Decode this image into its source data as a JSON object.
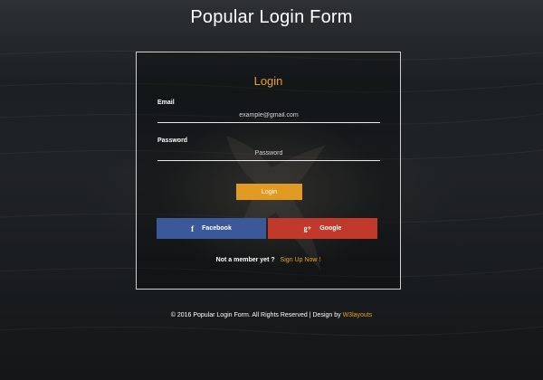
{
  "page": {
    "title": "Popular Login Form"
  },
  "form": {
    "heading": "Login",
    "email_label": "Email",
    "email_placeholder": "example@gmail.com",
    "password_label": "Password",
    "password_placeholder": "Password",
    "login_button": "Login",
    "facebook_label": "Facebook",
    "facebook_icon": "f",
    "google_label": "Google",
    "google_icon": "g+",
    "signup_prompt": "Not a member yet ?",
    "signup_link": "Sign Up Now !"
  },
  "footer": {
    "text": "© 2016 Popular Login Form. All Rights Reserved | Design by",
    "link": "W3layouts"
  },
  "colors": {
    "accent": "#e19a22",
    "facebook": "#3b5998",
    "google": "#c0392b"
  }
}
